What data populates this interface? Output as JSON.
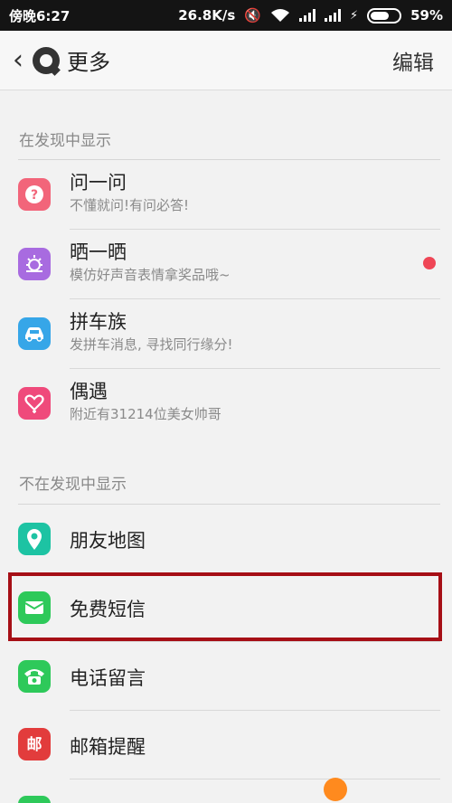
{
  "status_bar": {
    "time": "傍晚6:27",
    "speed": "26.8K/s",
    "battery": "59%"
  },
  "nav": {
    "back_icon": "chevron-left-icon",
    "title": "更多",
    "edit_label": "编辑"
  },
  "section_shown": {
    "header": "在发现中显示",
    "items": [
      {
        "title": "问一问",
        "subtitle": "不懂就问!有问必答!",
        "icon": "question-icon",
        "color": "#f2657a"
      },
      {
        "title": "晒一晒",
        "subtitle": "模仿好声音表情拿奖品哦~",
        "icon": "sun-icon",
        "color": "#a86be0",
        "has_badge": true
      },
      {
        "title": "拼车族",
        "subtitle": "发拼车消息, 寻找同行缘分!",
        "icon": "car-icon",
        "color": "#36a6e8"
      },
      {
        "title": "偶遇",
        "subtitle": "附近有31214位美女帅哥",
        "icon": "heart-icon",
        "color": "#ef4a7b"
      }
    ]
  },
  "section_hidden": {
    "header": "不在发现中显示",
    "items": [
      {
        "title": "朋友地图",
        "icon": "map-pin-icon",
        "color": "#1dc3a3"
      },
      {
        "title": "免费短信",
        "icon": "message-icon",
        "color": "#2ec95a"
      },
      {
        "title": "电话留言",
        "icon": "phone-icon",
        "color": "#2ec95a"
      },
      {
        "title": "邮箱提醒",
        "icon": "mail-icon",
        "color": "#e23c3c"
      }
    ]
  },
  "colors": {
    "badge": "#ef4656",
    "highlight": "#a60f16"
  }
}
